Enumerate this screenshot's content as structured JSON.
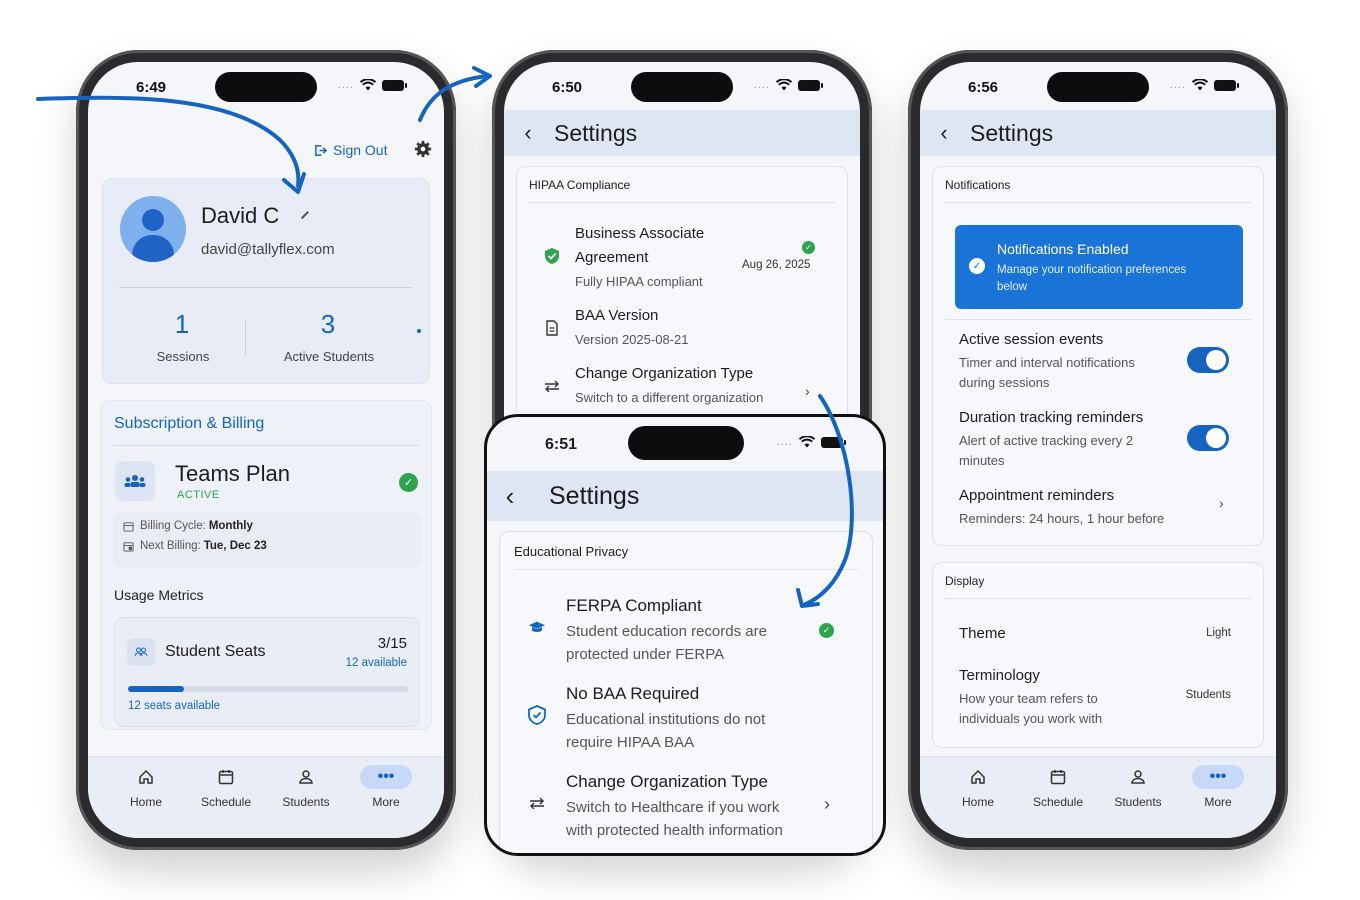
{
  "status": {
    "time1": "6:49",
    "time2": "6:50",
    "time3": "6:51",
    "time4": "6:56",
    "dots": "...."
  },
  "phone1": {
    "sign_out": "Sign Out",
    "profile": {
      "name": "David C",
      "email": "david@tallyflex.com"
    },
    "stats": [
      {
        "value": "1",
        "label": "Sessions"
      },
      {
        "value": "3",
        "label": "Active Students"
      }
    ],
    "subscription": {
      "section_title": "Subscription & Billing",
      "plan": "Teams Plan",
      "plan_status": "ACTIVE",
      "billing_cycle_label": "Billing Cycle:",
      "billing_cycle_value": "Monthly",
      "next_billing_label": "Next Billing:",
      "next_billing_value": "Tue, Dec 23"
    },
    "usage": {
      "title": "Usage Metrics",
      "seats_label": "Student Seats",
      "seats_count": "3/15",
      "seats_available": "12 available",
      "seats_footer": "12 seats available",
      "seats_fraction": 0.2
    }
  },
  "phone2": {
    "title": "Settings",
    "card_title": "HIPAA Compliance",
    "baa": {
      "title1": "Business Associate",
      "title2": "Agreement",
      "sub": "Fully HIPAA compliant",
      "date": "Aug 26, 2025"
    },
    "version": {
      "title": "BAA Version",
      "sub": "Version 2025-08-21"
    },
    "change": {
      "title": "Change Organization Type",
      "sub": "Switch to a different organization"
    }
  },
  "phone3": {
    "title": "Settings",
    "card_title": "Educational Privacy",
    "ferpa": {
      "title": "FERPA Compliant",
      "sub1": "Student education records are",
      "sub2": "protected under FERPA"
    },
    "nobaa": {
      "title": "No BAA Required",
      "sub1": "Educational institutions do not",
      "sub2": "require HIPAA BAA"
    },
    "change": {
      "title": "Change Organization Type",
      "sub1": "Switch to Healthcare if you work",
      "sub2": "with protected health information"
    }
  },
  "phone4": {
    "title": "Settings",
    "notifications": {
      "card_title": "Notifications",
      "banner_title": "Notifications Enabled",
      "banner_sub1": "Manage your notification preferences",
      "banner_sub2": "below",
      "active": {
        "title": "Active session events",
        "sub1": "Timer and interval notifications",
        "sub2": "during sessions"
      },
      "duration": {
        "title": "Duration tracking reminders",
        "sub1": "Alert of active tracking every 2",
        "sub2": "minutes"
      },
      "appointment": {
        "title": "Appointment reminders",
        "sub": "Reminders: 24 hours, 1 hour before"
      }
    },
    "display": {
      "card_title": "Display",
      "theme_label": "Theme",
      "theme_value": "Light",
      "term_label": "Terminology",
      "term_sub1": "How your team refers to",
      "term_sub2": "individuals you work with",
      "term_value": "Students"
    }
  },
  "nav": {
    "home": "Home",
    "schedule": "Schedule",
    "students": "Students",
    "more": "More"
  },
  "colors": {
    "accent": "#1565c0",
    "success": "#2ea44f",
    "appbar": "#dfe6f3",
    "arrow": "#1565c0"
  }
}
